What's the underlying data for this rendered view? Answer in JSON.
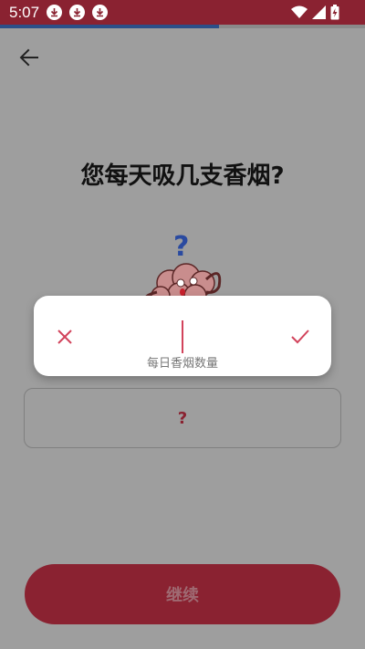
{
  "status_bar": {
    "time": "5:07",
    "notification_icons": [
      "download-icon",
      "download-icon",
      "download-icon"
    ],
    "right_icons": [
      "wifi-icon",
      "signal-icon",
      "battery-charging-icon"
    ]
  },
  "progress": {
    "value": 0.6
  },
  "question": {
    "title": "您每天吸几支香烟?"
  },
  "answer": {
    "value": "?"
  },
  "continue_button": {
    "label": "继续"
  },
  "dialog": {
    "input_value": "",
    "hint": "每日香烟数量",
    "cancel_icon": "close-icon",
    "confirm_icon": "check-icon"
  },
  "colors": {
    "brand": "#8a2231",
    "accent_red": "#d2435b",
    "progress": "#2b4f89",
    "scrim": "#9e9e9e"
  }
}
